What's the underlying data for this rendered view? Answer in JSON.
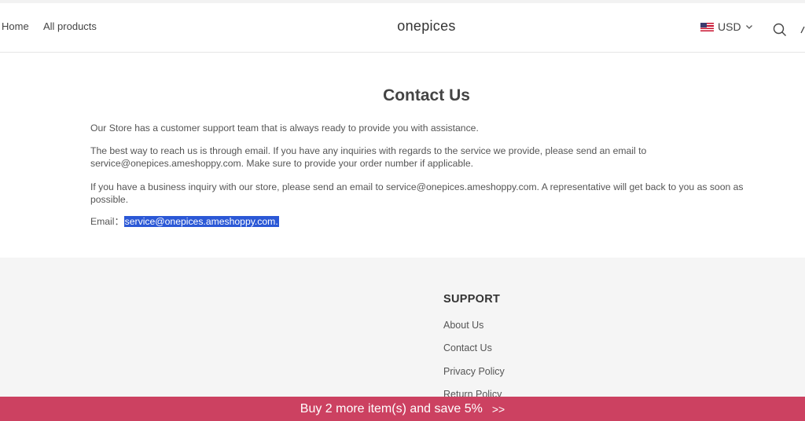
{
  "header": {
    "nav": [
      {
        "label": "Home"
      },
      {
        "label": "All products"
      }
    ],
    "brand": "onepices",
    "currency": {
      "code": "USD",
      "flag_icon": "us-flag-icon"
    },
    "icons": [
      "search-icon",
      "account-icon",
      "chevron-down-icon"
    ]
  },
  "main": {
    "title": "Contact Us",
    "paragraphs": [
      "Our Store has a customer support team that is always ready to provide you with assistance.",
      "The best way to reach us is through email. If you have any inquiries with regards to the service we provide, please send an email to service@onepices.ameshoppy.com. Make sure to provide your order number if applicable.",
      "If you have a business inquiry with our store, please send an email to service@onepices.ameshoppy.com. A representative will get back to you as soon as possible."
    ],
    "email_label": "Email：",
    "email": "service@onepices.ameshoppy.com."
  },
  "footer": {
    "heading": "SUPPORT",
    "links": [
      {
        "label": "About Us"
      },
      {
        "label": "Contact Us"
      },
      {
        "label": "Privacy Policy"
      },
      {
        "label": "Return Policy"
      }
    ]
  },
  "promo": {
    "text": "Buy 2 more item(s) and save 5%",
    "arrows": ">>"
  },
  "colors": {
    "promo_bg": "#cc4161",
    "selection": "#2b58d6",
    "footer_bg": "#f5f5f5"
  }
}
